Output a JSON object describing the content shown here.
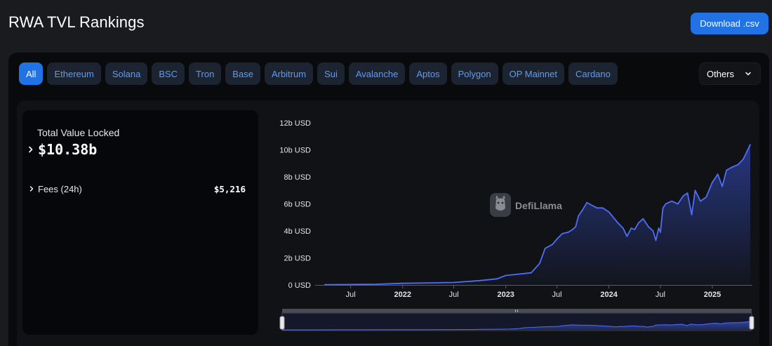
{
  "header": {
    "title": "RWA TVL Rankings",
    "download_label": "Download .csv"
  },
  "chain_tabs": [
    "All",
    "Ethereum",
    "Solana",
    "BSC",
    "Tron",
    "Base",
    "Arbitrum",
    "Sui",
    "Avalanche",
    "Aptos",
    "Polygon",
    "OP Mainnet",
    "Cardano"
  ],
  "active_tab": "All",
  "others_label": "Others",
  "stats": {
    "tvl_label": "Total Value Locked",
    "tvl_value": "$10.38b",
    "fees_label": "Fees (24h)",
    "fees_value": "$5,216"
  },
  "watermark": "DefiLlama",
  "colors": {
    "accent": "#2172e5",
    "line": "#4f6ef7",
    "tab_bg": "#1c2331",
    "tab_text": "#5d9cf5"
  },
  "icons": {
    "tvl_expand": "chevron-right-icon",
    "fees_expand": "chevron-right-icon",
    "others_dropdown": "chevron-down-icon",
    "watermark_logo": "llama-logo-icon"
  },
  "chart_data": {
    "type": "area",
    "title": "",
    "xlabel": "",
    "ylabel": "",
    "ylim": [
      0,
      12
    ],
    "y_ticks": [
      0,
      2,
      4,
      6,
      8,
      10,
      12
    ],
    "y_tick_labels": [
      "0 USD",
      "2b USD",
      "4b USD",
      "6b USD",
      "8b USD",
      "10b USD",
      "12b USD"
    ],
    "x_range": [
      "2021-04-01",
      "2025-05-15"
    ],
    "x_ticks": [
      {
        "date": "2021-07-01",
        "label": "Jul"
      },
      {
        "date": "2022-01-01",
        "label": "2022"
      },
      {
        "date": "2022-07-01",
        "label": "Jul"
      },
      {
        "date": "2023-01-01",
        "label": "2023"
      },
      {
        "date": "2023-07-01",
        "label": "Jul"
      },
      {
        "date": "2024-01-01",
        "label": "2024"
      },
      {
        "date": "2024-07-01",
        "label": "Jul"
      },
      {
        "date": "2025-01-01",
        "label": "2025"
      }
    ],
    "grid": false,
    "legend": "none",
    "series": [
      {
        "unit": "b USD",
        "points": [
          [
            "2021-04-01",
            0.02
          ],
          [
            "2021-07-01",
            0.03
          ],
          [
            "2021-10-01",
            0.05
          ],
          [
            "2022-01-01",
            0.12
          ],
          [
            "2022-04-01",
            0.15
          ],
          [
            "2022-07-01",
            0.18
          ],
          [
            "2022-10-01",
            0.32
          ],
          [
            "2022-12-01",
            0.45
          ],
          [
            "2023-01-01",
            0.7
          ],
          [
            "2023-02-15",
            0.8
          ],
          [
            "2023-04-01",
            0.9
          ],
          [
            "2023-05-01",
            1.6
          ],
          [
            "2023-05-20",
            2.7
          ],
          [
            "2023-06-15",
            3.0
          ],
          [
            "2023-07-01",
            3.4
          ],
          [
            "2023-07-20",
            3.8
          ],
          [
            "2023-08-10",
            3.9
          ],
          [
            "2023-08-25",
            4.1
          ],
          [
            "2023-09-05",
            4.3
          ],
          [
            "2023-09-15",
            5.1
          ],
          [
            "2023-10-01",
            5.6
          ],
          [
            "2023-10-15",
            6.1
          ],
          [
            "2023-11-01",
            5.9
          ],
          [
            "2023-11-20",
            5.7
          ],
          [
            "2023-12-10",
            5.7
          ],
          [
            "2024-01-01",
            5.4
          ],
          [
            "2024-02-01",
            4.6
          ],
          [
            "2024-02-20",
            4.2
          ],
          [
            "2024-03-05",
            3.6
          ],
          [
            "2024-03-20",
            4.2
          ],
          [
            "2024-04-01",
            4.1
          ],
          [
            "2024-04-15",
            4.6
          ],
          [
            "2024-05-01",
            4.9
          ],
          [
            "2024-05-20",
            4.3
          ],
          [
            "2024-06-05",
            4.0
          ],
          [
            "2024-06-15",
            3.3
          ],
          [
            "2024-06-25",
            4.2
          ],
          [
            "2024-07-01",
            3.9
          ],
          [
            "2024-07-10",
            5.7
          ],
          [
            "2024-07-20",
            6.0
          ],
          [
            "2024-08-10",
            6.2
          ],
          [
            "2024-09-01",
            6.0
          ],
          [
            "2024-09-20",
            6.6
          ],
          [
            "2024-10-05",
            6.8
          ],
          [
            "2024-10-20",
            5.2
          ],
          [
            "2024-11-01",
            7.0
          ],
          [
            "2024-11-20",
            6.2
          ],
          [
            "2024-12-10",
            6.5
          ],
          [
            "2025-01-01",
            7.6
          ],
          [
            "2025-01-20",
            8.2
          ],
          [
            "2025-02-05",
            7.3
          ],
          [
            "2025-02-20",
            8.5
          ],
          [
            "2025-03-10",
            8.7
          ],
          [
            "2025-04-01",
            8.9
          ],
          [
            "2025-04-20",
            9.3
          ],
          [
            "2025-05-15",
            10.38
          ]
        ]
      }
    ]
  }
}
